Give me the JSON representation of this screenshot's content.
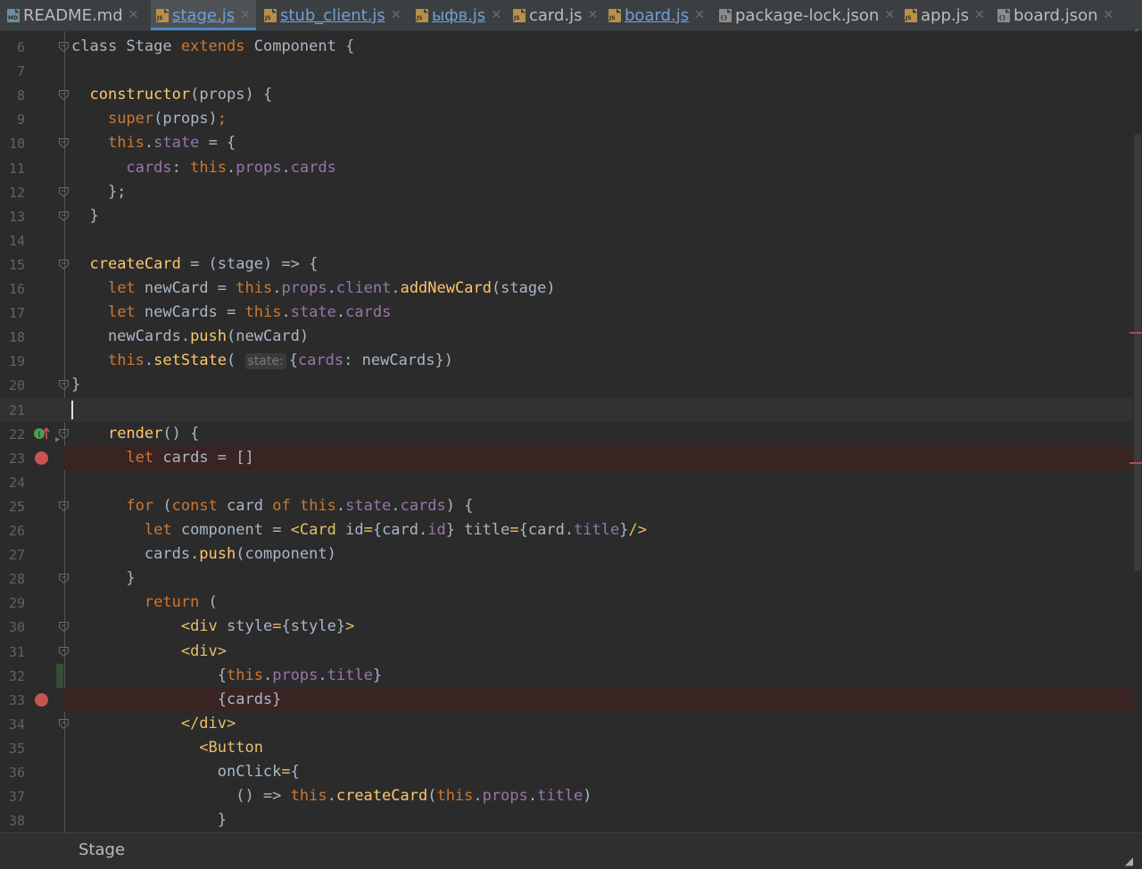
{
  "tabs": [
    {
      "label": "README.md",
      "icon": "markdown-file-icon",
      "icon_text": "MD"
    },
    {
      "label": "stage.js",
      "icon": "js-file-icon",
      "icon_text": "JS",
      "active": true
    },
    {
      "label": "stub_client.js",
      "icon": "js-file-icon",
      "icon_text": "JS"
    },
    {
      "label": "ыфв.js",
      "icon": "js-file-icon",
      "icon_text": "JS"
    },
    {
      "label": "card.js",
      "icon": "js-file-icon",
      "icon_text": "JS"
    },
    {
      "label": "board.js",
      "icon": "js-file-icon",
      "icon_text": "JS"
    },
    {
      "label": "package-lock.json",
      "icon": "json-file-icon",
      "icon_text": "{}"
    },
    {
      "label": "app.js",
      "icon": "js-file-icon",
      "icon_text": "JS"
    },
    {
      "label": "board.json",
      "icon": "json-file-icon",
      "icon_text": "{}"
    }
  ],
  "lines": [
    {
      "n": "6"
    },
    {
      "n": "7"
    },
    {
      "n": "8"
    },
    {
      "n": "9"
    },
    {
      "n": "10"
    },
    {
      "n": "11"
    },
    {
      "n": "12"
    },
    {
      "n": "13"
    },
    {
      "n": "14"
    },
    {
      "n": "15"
    },
    {
      "n": "16"
    },
    {
      "n": "17"
    },
    {
      "n": "18"
    },
    {
      "n": "19"
    },
    {
      "n": "20"
    },
    {
      "n": "21"
    },
    {
      "n": "22"
    },
    {
      "n": "23"
    },
    {
      "n": "24"
    },
    {
      "n": "25"
    },
    {
      "n": "26"
    },
    {
      "n": "27"
    },
    {
      "n": "28"
    },
    {
      "n": "29"
    },
    {
      "n": "30"
    },
    {
      "n": "31"
    },
    {
      "n": "32"
    },
    {
      "n": "33"
    },
    {
      "n": "34"
    },
    {
      "n": "35"
    },
    {
      "n": "36"
    },
    {
      "n": "37"
    },
    {
      "n": "38"
    }
  ],
  "code": {
    "l6": [
      [
        "t",
        "class "
      ],
      [
        "t",
        "Stage "
      ],
      [
        "kw",
        "extends "
      ],
      [
        "t",
        "Component {"
      ]
    ],
    "l7": [],
    "l8": [
      [
        "t",
        "  "
      ],
      [
        "fn",
        "constructor"
      ],
      [
        "t",
        "(props) {"
      ]
    ],
    "l9": [
      [
        "t",
        "    "
      ],
      [
        "kw",
        "super"
      ],
      [
        "t",
        "(props)"
      ],
      [
        "kw",
        ";"
      ]
    ],
    "l10": [
      [
        "t",
        "    "
      ],
      [
        "kw",
        "this"
      ],
      [
        "t",
        "."
      ],
      [
        "pr",
        "state"
      ],
      [
        "t",
        " = {"
      ]
    ],
    "l11": [
      [
        "t",
        "      "
      ],
      [
        "pr",
        "cards"
      ],
      [
        "t",
        ": "
      ],
      [
        "kw",
        "this"
      ],
      [
        "t",
        "."
      ],
      [
        "pr",
        "props"
      ],
      [
        "t",
        "."
      ],
      [
        "pr",
        "cards"
      ]
    ],
    "l12": [
      [
        "t",
        "    };"
      ]
    ],
    "l13": [
      [
        "t",
        "  }"
      ]
    ],
    "l14": [],
    "l15": [
      [
        "t",
        "  "
      ],
      [
        "fn",
        "createCard"
      ],
      [
        "t",
        " = (stage) => {"
      ]
    ],
    "l16": [
      [
        "t",
        "    "
      ],
      [
        "kw",
        "let "
      ],
      [
        "t",
        "newCard = "
      ],
      [
        "kw",
        "this"
      ],
      [
        "t",
        "."
      ],
      [
        "pr",
        "props"
      ],
      [
        "t",
        "."
      ],
      [
        "pr",
        "client"
      ],
      [
        "t",
        "."
      ],
      [
        "fn",
        "addNewCard"
      ],
      [
        "t",
        "(stage)"
      ]
    ],
    "l17": [
      [
        "t",
        "    "
      ],
      [
        "kw",
        "let "
      ],
      [
        "t",
        "newCards = "
      ],
      [
        "kw",
        "this"
      ],
      [
        "t",
        "."
      ],
      [
        "pr",
        "state"
      ],
      [
        "t",
        "."
      ],
      [
        "pr",
        "cards"
      ]
    ],
    "l18": [
      [
        "t",
        "    newCards."
      ],
      [
        "fn",
        "push"
      ],
      [
        "t",
        "(newCard)"
      ]
    ],
    "l19": [
      [
        "t",
        "    "
      ],
      [
        "kw",
        "this"
      ],
      [
        "t",
        "."
      ],
      [
        "fn",
        "setState"
      ],
      [
        "t",
        "( "
      ],
      [
        "hint",
        "state:"
      ],
      [
        "t",
        "{"
      ],
      [
        "pr",
        "cards"
      ],
      [
        "t",
        ": newCards})"
      ]
    ],
    "l20": [
      [
        "t",
        "}"
      ]
    ],
    "l21": [],
    "l22": [
      [
        "t",
        "    "
      ],
      [
        "fn",
        "render"
      ],
      [
        "t",
        "() {"
      ]
    ],
    "l23": [
      [
        "t",
        "      "
      ],
      [
        "kw",
        "let "
      ],
      [
        "t",
        "cards = []"
      ]
    ],
    "l24": [],
    "l25": [
      [
        "t",
        "      "
      ],
      [
        "kw",
        "for "
      ],
      [
        "t",
        "("
      ],
      [
        "kw",
        "const "
      ],
      [
        "t",
        "card "
      ],
      [
        "kw",
        "of "
      ],
      [
        "kw",
        "this"
      ],
      [
        "t",
        "."
      ],
      [
        "pr",
        "state"
      ],
      [
        "t",
        "."
      ],
      [
        "pr",
        "cards"
      ],
      [
        "t",
        ") {"
      ]
    ],
    "l26": [
      [
        "t",
        "        "
      ],
      [
        "kw",
        "let "
      ],
      [
        "t",
        "component = "
      ],
      [
        "tg",
        "<Card "
      ],
      [
        "t",
        "id"
      ],
      [
        "tg",
        "="
      ],
      [
        "t",
        "{card."
      ],
      [
        "pr",
        "id"
      ],
      [
        "t",
        "} title"
      ],
      [
        "tg",
        "="
      ],
      [
        "t",
        "{card."
      ],
      [
        "pr",
        "title"
      ],
      [
        "t",
        "}"
      ],
      [
        "tg",
        "/>"
      ]
    ],
    "l27": [
      [
        "t",
        "        cards."
      ],
      [
        "fn",
        "push"
      ],
      [
        "t",
        "(component)"
      ]
    ],
    "l28": [
      [
        "t",
        "      }"
      ]
    ],
    "l29": [
      [
        "t",
        "        "
      ],
      [
        "kw",
        "return "
      ],
      [
        "t",
        "("
      ]
    ],
    "l30": [
      [
        "t",
        "            "
      ],
      [
        "tg",
        "<div "
      ],
      [
        "t",
        "style"
      ],
      [
        "tg",
        "="
      ],
      [
        "t",
        "{style}"
      ],
      [
        "tg",
        ">"
      ]
    ],
    "l31": [
      [
        "t",
        "            "
      ],
      [
        "tg",
        "<div>"
      ]
    ],
    "l32": [
      [
        "t",
        "                {"
      ],
      [
        "kw",
        "this"
      ],
      [
        "t",
        "."
      ],
      [
        "pr",
        "props"
      ],
      [
        "t",
        "."
      ],
      [
        "pr",
        "title"
      ],
      [
        "t",
        "}"
      ]
    ],
    "l33": [
      [
        "t",
        "                {cards}"
      ]
    ],
    "l34": [
      [
        "t",
        "            "
      ],
      [
        "tg",
        "</div>"
      ]
    ],
    "l35": [
      [
        "t",
        "              "
      ],
      [
        "tg",
        "<Button"
      ]
    ],
    "l36": [
      [
        "t",
        "                onClick"
      ],
      [
        "tg",
        "="
      ],
      [
        "t",
        "{"
      ]
    ],
    "l37": [
      [
        "t",
        "                  () => "
      ],
      [
        "kw",
        "this"
      ],
      [
        "t",
        "."
      ],
      [
        "fn",
        "createCard"
      ],
      [
        "t",
        "("
      ],
      [
        "kw",
        "this"
      ],
      [
        "t",
        "."
      ],
      [
        "pr",
        "props"
      ],
      [
        "t",
        "."
      ],
      [
        "pr",
        "title"
      ],
      [
        "t",
        ")"
      ]
    ],
    "l38": [
      [
        "t",
        "                }"
      ]
    ]
  },
  "breadcrumb": {
    "label": "Stage"
  },
  "status": {
    "inspection": "ok-check-icon"
  },
  "colors": {
    "keyword": "#cc7832",
    "function": "#ffc66d",
    "property": "#9876aa",
    "tag": "#e8bf6a",
    "text": "#a9b7c6",
    "breakpoint": "#c75450"
  }
}
